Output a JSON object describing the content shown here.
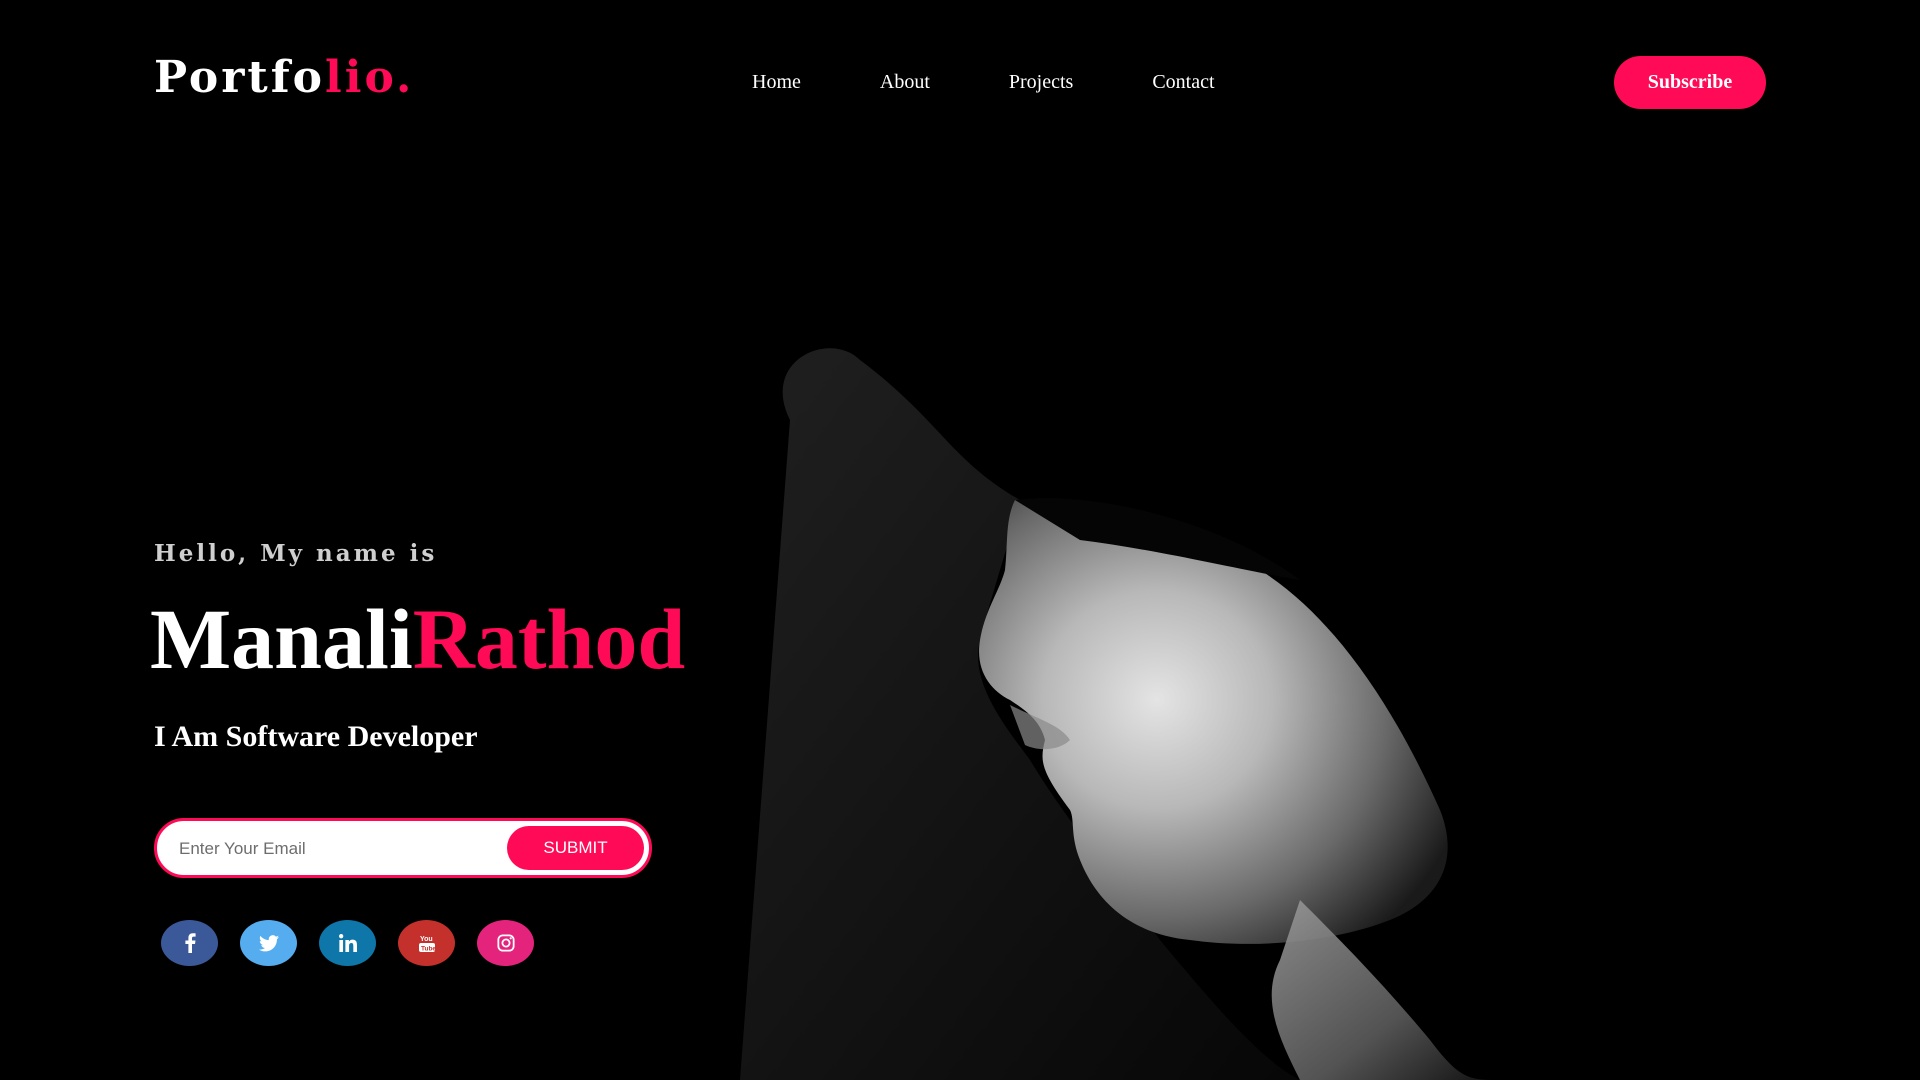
{
  "header": {
    "logo_main": "Portfo",
    "logo_accent": "lio.",
    "nav": [
      {
        "label": "Home"
      },
      {
        "label": "About"
      },
      {
        "label": "Projects"
      },
      {
        "label": "Contact"
      }
    ],
    "subscribe_label": "Subscribe"
  },
  "hero": {
    "greeting": "Hello, My name is",
    "first_name": "Manali",
    "last_name": "Rathod",
    "role": "I Am Software Developer"
  },
  "form": {
    "email_placeholder": "Enter Your Email",
    "email_value": "",
    "submit_label": "SUBMIT"
  },
  "social": [
    {
      "icon": "facebook-icon",
      "color": "#3b5998"
    },
    {
      "icon": "twitter-icon",
      "color": "#55acee"
    },
    {
      "icon": "linkedin-icon",
      "color": "#0e76a8"
    },
    {
      "icon": "youtube-icon",
      "color": "#c4302b"
    },
    {
      "icon": "instagram-icon",
      "color": "#e4237d"
    }
  ],
  "colors": {
    "accent": "#ff0a57",
    "background": "#000000",
    "text": "#ffffff"
  }
}
